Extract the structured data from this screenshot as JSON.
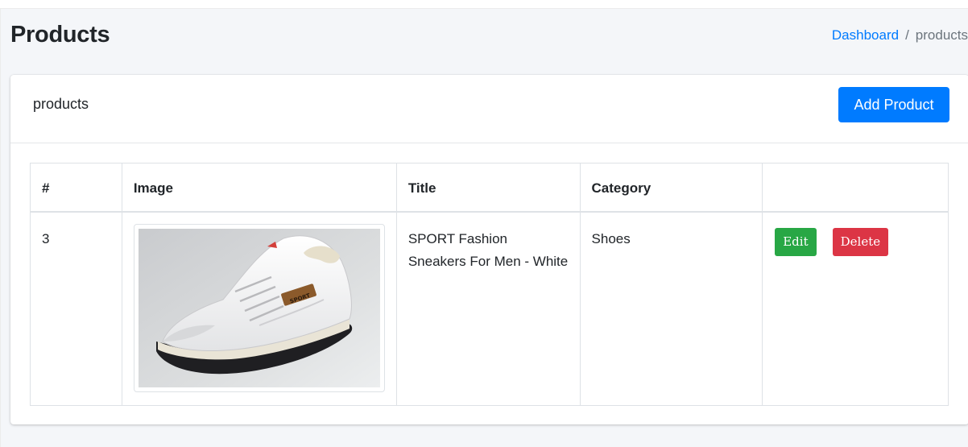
{
  "header": {
    "title": "Products",
    "breadcrumb": {
      "link": "Dashboard",
      "separator": "/",
      "current": "products"
    }
  },
  "card": {
    "title": "products",
    "add_button": "Add Product"
  },
  "table": {
    "columns": [
      "#",
      "Image",
      "Title",
      "Category",
      ""
    ],
    "rows": [
      {
        "id": "3",
        "image_label": "SPORT",
        "title": "SPORT Fashion Sneakers For Men - White",
        "category": "Shoes",
        "edit_label": "Edit",
        "delete_label": "Delete"
      }
    ]
  },
  "colors": {
    "primary": "#007bff",
    "success": "#28a745",
    "danger": "#dc3545",
    "background": "#f4f6f9"
  }
}
